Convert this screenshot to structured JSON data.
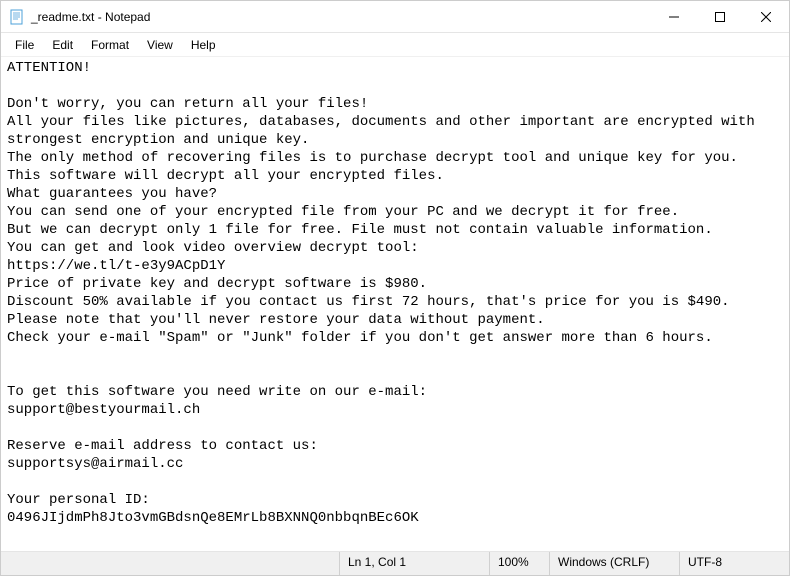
{
  "window": {
    "title": "_readme.txt - Notepad"
  },
  "menu": {
    "file": "File",
    "edit": "Edit",
    "format": "Format",
    "view": "View",
    "help": "Help"
  },
  "document": {
    "text": "ATTENTION!\n\nDon't worry, you can return all your files!\nAll your files like pictures, databases, documents and other important are encrypted with strongest encryption and unique key.\nThe only method of recovering files is to purchase decrypt tool and unique key for you.\nThis software will decrypt all your encrypted files.\nWhat guarantees you have?\nYou can send one of your encrypted file from your PC and we decrypt it for free.\nBut we can decrypt only 1 file for free. File must not contain valuable information.\nYou can get and look video overview decrypt tool:\nhttps://we.tl/t-e3y9ACpD1Y\nPrice of private key and decrypt software is $980.\nDiscount 50% available if you contact us first 72 hours, that's price for you is $490.\nPlease note that you'll never restore your data without payment.\nCheck your e-mail \"Spam\" or \"Junk\" folder if you don't get answer more than 6 hours.\n\n\nTo get this software you need write on our e-mail:\nsupport@bestyourmail.ch\n\nReserve e-mail address to contact us:\nsupportsys@airmail.cc\n\nYour personal ID:\n0496JIjdmPh8Jto3vmGBdsnQe8EMrLb8BXNNQ0nbbqnBEc6OK"
  },
  "status": {
    "position": "Ln 1, Col 1",
    "zoom": "100%",
    "eol": "Windows (CRLF)",
    "encoding": "UTF-8"
  }
}
